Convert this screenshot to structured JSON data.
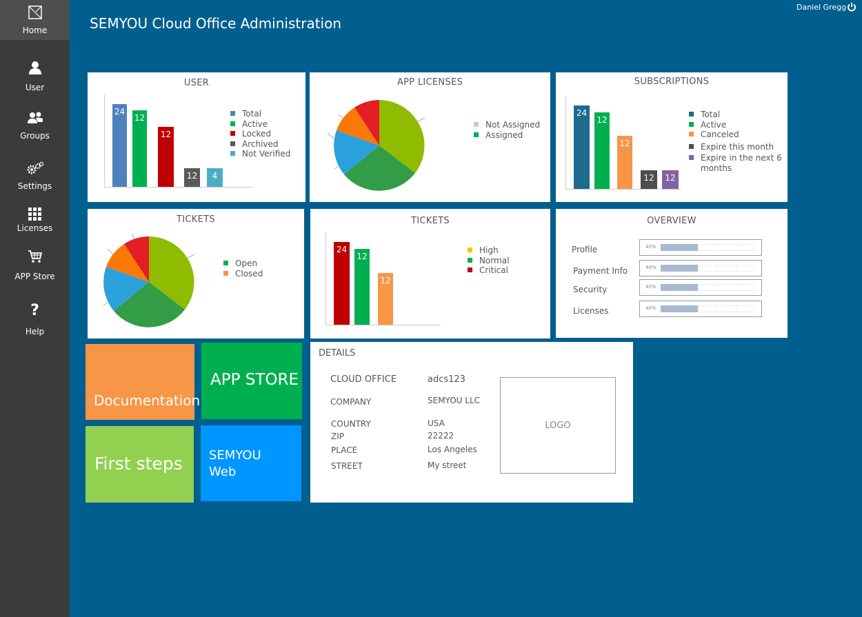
{
  "header": {
    "title": "SEMYOU Cloud Office Administration",
    "user_name": "Daniel Gregg"
  },
  "sidebar": {
    "items": [
      {
        "label": "Home",
        "icon": "home-icon"
      },
      {
        "label": "User",
        "icon": "user-icon"
      },
      {
        "label": "Groups",
        "icon": "groups-icon"
      },
      {
        "label": "Settings",
        "icon": "settings-icon"
      },
      {
        "label": "Licenses",
        "icon": "licenses-icon"
      },
      {
        "label": "APP Store",
        "icon": "cart-icon"
      },
      {
        "label": "Help",
        "icon": "help-icon"
      }
    ],
    "help_glyph": "?"
  },
  "user_panel": {
    "title": "USER",
    "bars": [
      {
        "value": "24",
        "color": "#4f81bd"
      },
      {
        "value": "12",
        "color": "#00b050"
      },
      {
        "value": "12",
        "color": "#c00000"
      },
      {
        "value": "12",
        "color": "#595959"
      },
      {
        "value": "4",
        "color": "#4bacc6"
      }
    ],
    "legend": [
      {
        "label": "Total",
        "color": "#4f81bd"
      },
      {
        "label": "Active",
        "color": "#00b050"
      },
      {
        "label": "Locked",
        "color": "#c00000"
      },
      {
        "label": "Archived",
        "color": "#595959"
      },
      {
        "label": "Not Verified",
        "color": "#4bacc6"
      }
    ]
  },
  "app_licenses_panel": {
    "title": "APP LICENSES",
    "legend": [
      {
        "label": "Not Assigned",
        "color": "#b8cce4"
      },
      {
        "label": "Assigned",
        "color": "#00b050"
      }
    ]
  },
  "subscriptions_panel": {
    "title": "SUBSCRIPTIONS",
    "bars": [
      {
        "value": "24",
        "color": "#1f6a8f"
      },
      {
        "value": "12",
        "color": "#00b050"
      },
      {
        "value": "12",
        "color": "#f79646"
      },
      {
        "value": "12",
        "color": "#4d4d4d"
      },
      {
        "value": "12",
        "color": "#8064a2"
      }
    ],
    "legend": [
      {
        "label": "Total",
        "color": "#1f6a8f"
      },
      {
        "label": "Active",
        "color": "#00b050"
      },
      {
        "label": "Canceled",
        "color": "#f79646"
      },
      {
        "label": "Expire this month",
        "color": "#4d4d4d"
      },
      {
        "label": "Expire in the next 6 months",
        "color": "#8064a2"
      }
    ]
  },
  "tickets_pie_panel": {
    "title": "TICKETS",
    "legend": [
      {
        "label": "Open",
        "color": "#00b050"
      },
      {
        "label": "Closed",
        "color": "#f79646"
      }
    ]
  },
  "tickets_bar_panel": {
    "title": "TICKETS",
    "bars": [
      {
        "value": "24",
        "color": "#c00000"
      },
      {
        "value": "12",
        "color": "#00b050"
      },
      {
        "value": "12",
        "color": "#f79646"
      }
    ],
    "legend": [
      {
        "label": "High",
        "color": "#ffc000"
      },
      {
        "label": "Normal",
        "color": "#00b050"
      },
      {
        "label": "Critical",
        "color": "#c00000"
      }
    ]
  },
  "overview_panel": {
    "title": "OVERVIEW",
    "rows": [
      {
        "label": "Profile",
        "percent_text": "40%",
        "fraction": 0.4
      },
      {
        "label": "Payment Info",
        "percent_text": "40%",
        "fraction": 0.4
      },
      {
        "label": "Security",
        "percent_text": "40%",
        "fraction": 0.4
      },
      {
        "label": "Licenses",
        "percent_text": "40%",
        "fraction": 0.4
      }
    ]
  },
  "tiles": {
    "documentation": {
      "label": "Documentation",
      "color": "#f79646"
    },
    "app_store": {
      "label": "APP STORE",
      "color": "#00b050"
    },
    "first_steps": {
      "label": "First steps",
      "color": "#92d050"
    },
    "semyou_web": {
      "label": "SEMYOU Web",
      "color": "#0096ff"
    }
  },
  "details_panel": {
    "title": "DETAILS",
    "cloud_office_label": "CLOUD OFFICE",
    "cloud_office_value": "adcs123",
    "company_label": "COMPANY",
    "company_value": "SEMYOU LLC",
    "country_label": "COUNTRY",
    "country_value": "USA",
    "zip_label": "ZIP",
    "zip_value": "22222",
    "place_label": "PLACE",
    "place_value": "Los Angeles",
    "street_label": "STREET",
    "street_value": "My street",
    "logo_label": "LOGO"
  },
  "colors": {
    "background": "#005f8e",
    "sidebar": "#3b3b3b",
    "pie_lime": "#8fbc00",
    "pie_green": "#339c46",
    "pie_blue": "#2aa1db",
    "pie_orange": "#fb7808",
    "pie_red": "#e41e25"
  }
}
